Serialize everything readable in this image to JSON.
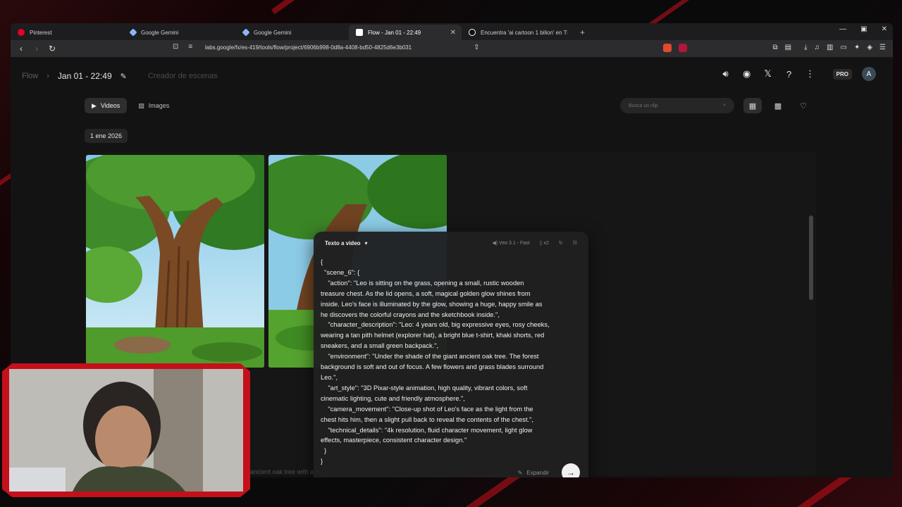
{
  "browser": {
    "tabs": [
      {
        "label": "Pinterest",
        "color": "#e60023",
        "active": false
      },
      {
        "label": "Google Gemini",
        "color": "#8ab4f8",
        "active": false
      },
      {
        "label": "Google Gemini",
        "color": "#8ab4f8",
        "active": false
      },
      {
        "label": "Flow - Jan 01 - 22:49",
        "color": "#ffffff",
        "active": true
      },
      {
        "label": "Encuentra 'ai cartoon 1 bilion' en Tik",
        "color": "#ffffff",
        "active": false
      }
    ],
    "new_tab": "+",
    "url": "labs.google/fx/es-419/tools/flow/project/6906b998-0d8a-4408-bd50-4825d6e3b031"
  },
  "header": {
    "crumb_root": "Flow",
    "crumb_current": "Jan 01 - 22:49",
    "crumb_next": "Creador de escenas",
    "pro_badge": "PRO",
    "avatar_initial": "A"
  },
  "filters": {
    "videos": "Videos",
    "images": "Images",
    "search_placeholder": "Busca un clip"
  },
  "date_label": "1 ene 2026",
  "panel": {
    "mode": "Texto a video",
    "model": "Veo 3.1 - Fast",
    "count": "x2",
    "prompt": "{\n  \"scene_6\": {\n    \"action\": \"Leo is sitting on the grass, opening a small, rustic wooden\ntreasure chest. As the lid opens, a soft, magical golden glow shines from\ninside. Leo's face is illuminated by the glow, showing a huge, happy smile as\nhe discovers the colorful crayons and the sketchbook inside.\",\n    \"character_description\": \"Leo: 4 years old, big expressive eyes, rosy cheeks,\nwearing a tan pith helmet (explorer hat), a bright blue t-shirt, khaki shorts, red\nsneakers, and a small green backpack.\",\n    \"environment\": \"Under the shade of the giant ancient oak tree. The forest\nbackground is soft and out of focus. A few flowers and grass blades surround\nLeo.\",\n    \"art_style\": \"3D Pixar-style animation, high quality, vibrant colors, soft\ncinematic lighting, cute and friendly atmosphere.\",\n    \"camera_movement\": \"Close-up shot of Leo's face as the light from the\nchest hits him, then a slight pull back to reveal the contents of the chest.\",\n    \"technical_details\": \"4k resolution, fluid character movement, light glow\neffects, masterpiece, consistent character design.\"\n  }\n}",
    "expand": "Expandir"
  },
  "caption_fragment": "ancient oak tree with a large",
  "thumb_overlay_text": "eo"
}
